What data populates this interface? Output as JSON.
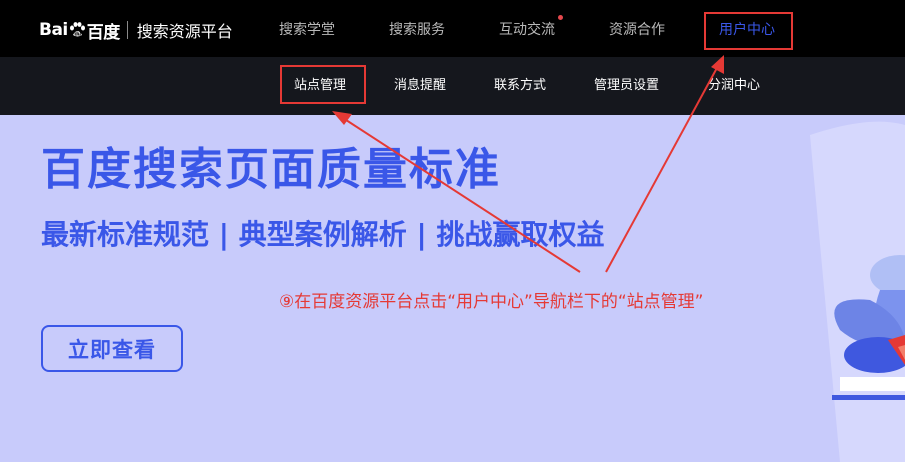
{
  "logo": {
    "brand_left": "Bai",
    "brand_right": "百度",
    "platform": "搜索资源平台"
  },
  "topnav": {
    "items": [
      {
        "label": "搜索学堂"
      },
      {
        "label": "搜索服务"
      },
      {
        "label": "互动交流"
      },
      {
        "label": "资源合作"
      },
      {
        "label": "用户中心"
      }
    ]
  },
  "subnav": {
    "items": [
      {
        "label": "站点管理"
      },
      {
        "label": "消息提醒"
      },
      {
        "label": "联系方式"
      },
      {
        "label": "管理员设置"
      },
      {
        "label": "分润中心"
      }
    ]
  },
  "hero": {
    "title": "百度搜索页面质量标准",
    "subtitle": "最新标准规范 | 典型案例解析 | 挑战赢取权益",
    "cta_label": "立即查看"
  },
  "annotation": {
    "text": "⑨在百度资源平台点击“用户中心”导航栏下的“站点管理”"
  },
  "colors": {
    "accent": "#3a57e8",
    "annotation_red": "#e53935",
    "hero_bg": "#c8cbfb",
    "topbar": "#000000",
    "subbar": "#15171d"
  },
  "icons": {
    "logo_mark": "baidu-paw-icon",
    "notification": "red-dot-badge"
  }
}
